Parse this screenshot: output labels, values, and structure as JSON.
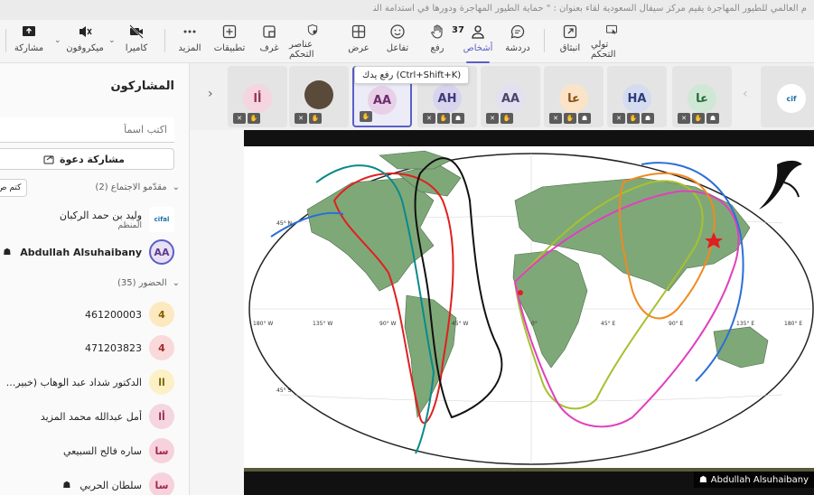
{
  "window": {
    "title": "م العالمي للطيور المهاجرة يقيم مركز سيفال السعودية لقاء بعنوان : \" حماية الطيور المهاجرة ودورها في استدامة النظ..."
  },
  "toolbar": {
    "share": "مشاركة",
    "mic": "ميكروفون",
    "camera": "كاميرا",
    "more": "المزيد",
    "apps": "تطبيقات",
    "rooms": "غرف",
    "controls": "عناصر التحكم",
    "view": "عرض",
    "react": "تفاعل",
    "raise": "رفع",
    "people": "أشخاص",
    "people_count": "37",
    "chat": "دردشة",
    "popout": "انبثاق",
    "take_control": "تولي التحكم"
  },
  "sidebar": {
    "title": "المشاركون",
    "search_placeholder": "اكتب اسماً",
    "invite_label": "مشاركة دعوة",
    "mute_all_label": "كتم ص",
    "presenters_heading": "مقدّمو الاجتماع (2)",
    "attendees_heading": "الحضور (35)",
    "presenters": [
      {
        "name": "وليد بن حمد الركبان",
        "role": "المنظم",
        "initials": "cifal"
      },
      {
        "name": "Abdullah Alsuhaibany",
        "role": "",
        "initials": "AA"
      }
    ],
    "attendees": [
      {
        "name": "461200003",
        "initials": "4"
      },
      {
        "name": "471203823",
        "initials": "4"
      },
      {
        "name": "الدكتور شداد عبد الوهاب (خبير...",
        "initials": "اا"
      },
      {
        "name": "أمل عبدالله محمد المزيد",
        "initials": "أا"
      },
      {
        "name": "ساره فالح السبيعي",
        "initials": "سا"
      },
      {
        "name": "سلطان الحربي",
        "initials": "سا"
      }
    ]
  },
  "strip": {
    "tooltip": "رفع يدك (Ctrl+Shift+K)",
    "tiles": [
      {
        "initials": "أا"
      },
      {
        "initials": ""
      },
      {
        "initials": "AA"
      },
      {
        "initials": "AH"
      },
      {
        "initials": "AA"
      },
      {
        "initials": "عا"
      },
      {
        "initials": "HA"
      },
      {
        "initials": "عا"
      },
      {
        "initials": "cif"
      }
    ]
  },
  "stage": {
    "presenter_tag": "Abdullah Alsuhaibany",
    "map_labels": [
      "45° N",
      "45° S",
      "180° W",
      "135° W",
      "90° W",
      "45° W",
      "0°",
      "45° E",
      "90° E",
      "135° E",
      "180° E"
    ]
  },
  "colors": {
    "accent": "#5b5fc7",
    "land": "#7fa878",
    "route_red": "#e02020",
    "route_black": "#111111",
    "route_blue": "#2b6fd6",
    "route_olive": "#a8c030",
    "route_magenta": "#e040c0",
    "route_orange": "#f08a20",
    "route_teal": "#0a8a8a"
  }
}
